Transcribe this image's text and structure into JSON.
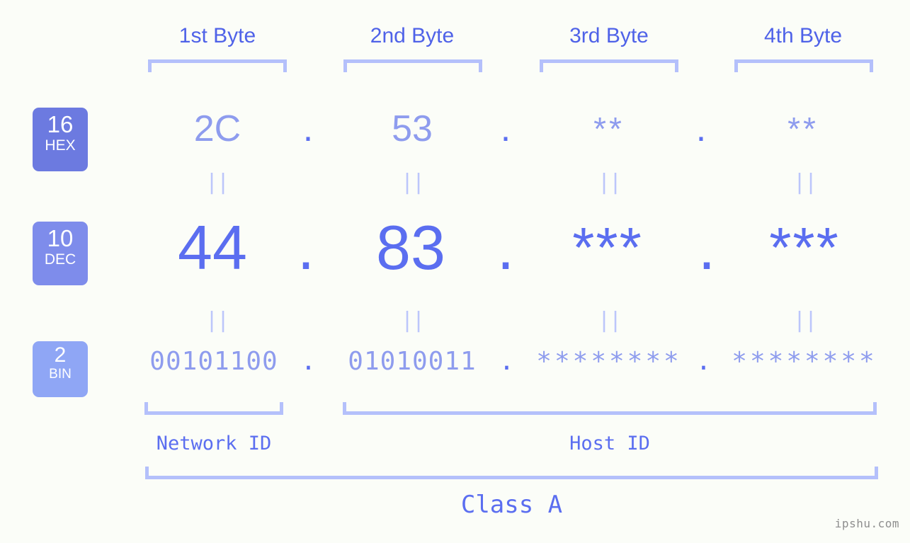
{
  "watermark": "ipshu.com",
  "header": {
    "byte_labels": [
      "1st Byte",
      "2nd Byte",
      "3rd Byte",
      "4th Byte"
    ]
  },
  "bases": [
    {
      "id": "hex",
      "number": "16",
      "name": "HEX",
      "color": "#6c7ae0"
    },
    {
      "id": "dec",
      "number": "10",
      "name": "DEC",
      "color": "#7e8ceb"
    },
    {
      "id": "bin",
      "number": "2",
      "name": "BIN",
      "color": "#8fa6f5"
    }
  ],
  "rows": {
    "hex": {
      "base_label": "HEX",
      "values": [
        "2C",
        "53",
        "**",
        "**"
      ],
      "separators": [
        ".",
        ".",
        "."
      ]
    },
    "dec": {
      "base_label": "DEC",
      "values": [
        "44",
        "83",
        "***",
        "***"
      ],
      "separators": [
        ".",
        ".",
        "."
      ]
    },
    "bin": {
      "base_label": "BIN",
      "values": [
        "00101100",
        "01010011",
        "********",
        "********"
      ],
      "separators": [
        ".",
        ".",
        "."
      ]
    }
  },
  "equals_marks": {
    "hex_to_dec": [
      "||",
      "||",
      "||",
      "||"
    ],
    "dec_to_bin": [
      "||",
      "||",
      "||",
      "||"
    ]
  },
  "footer": {
    "network_id_label": "Network ID",
    "host_id_label": "Host ID",
    "class_label": "Class A"
  },
  "colors": {
    "background": "#fbfdf8",
    "bracket": "#b4c0fb",
    "accent_strong": "#5b6ef0",
    "accent_light": "#8e9cee",
    "header_text": "#4f62e8",
    "equals": "#bcc6fb",
    "watermark": "#8e8e8e"
  }
}
